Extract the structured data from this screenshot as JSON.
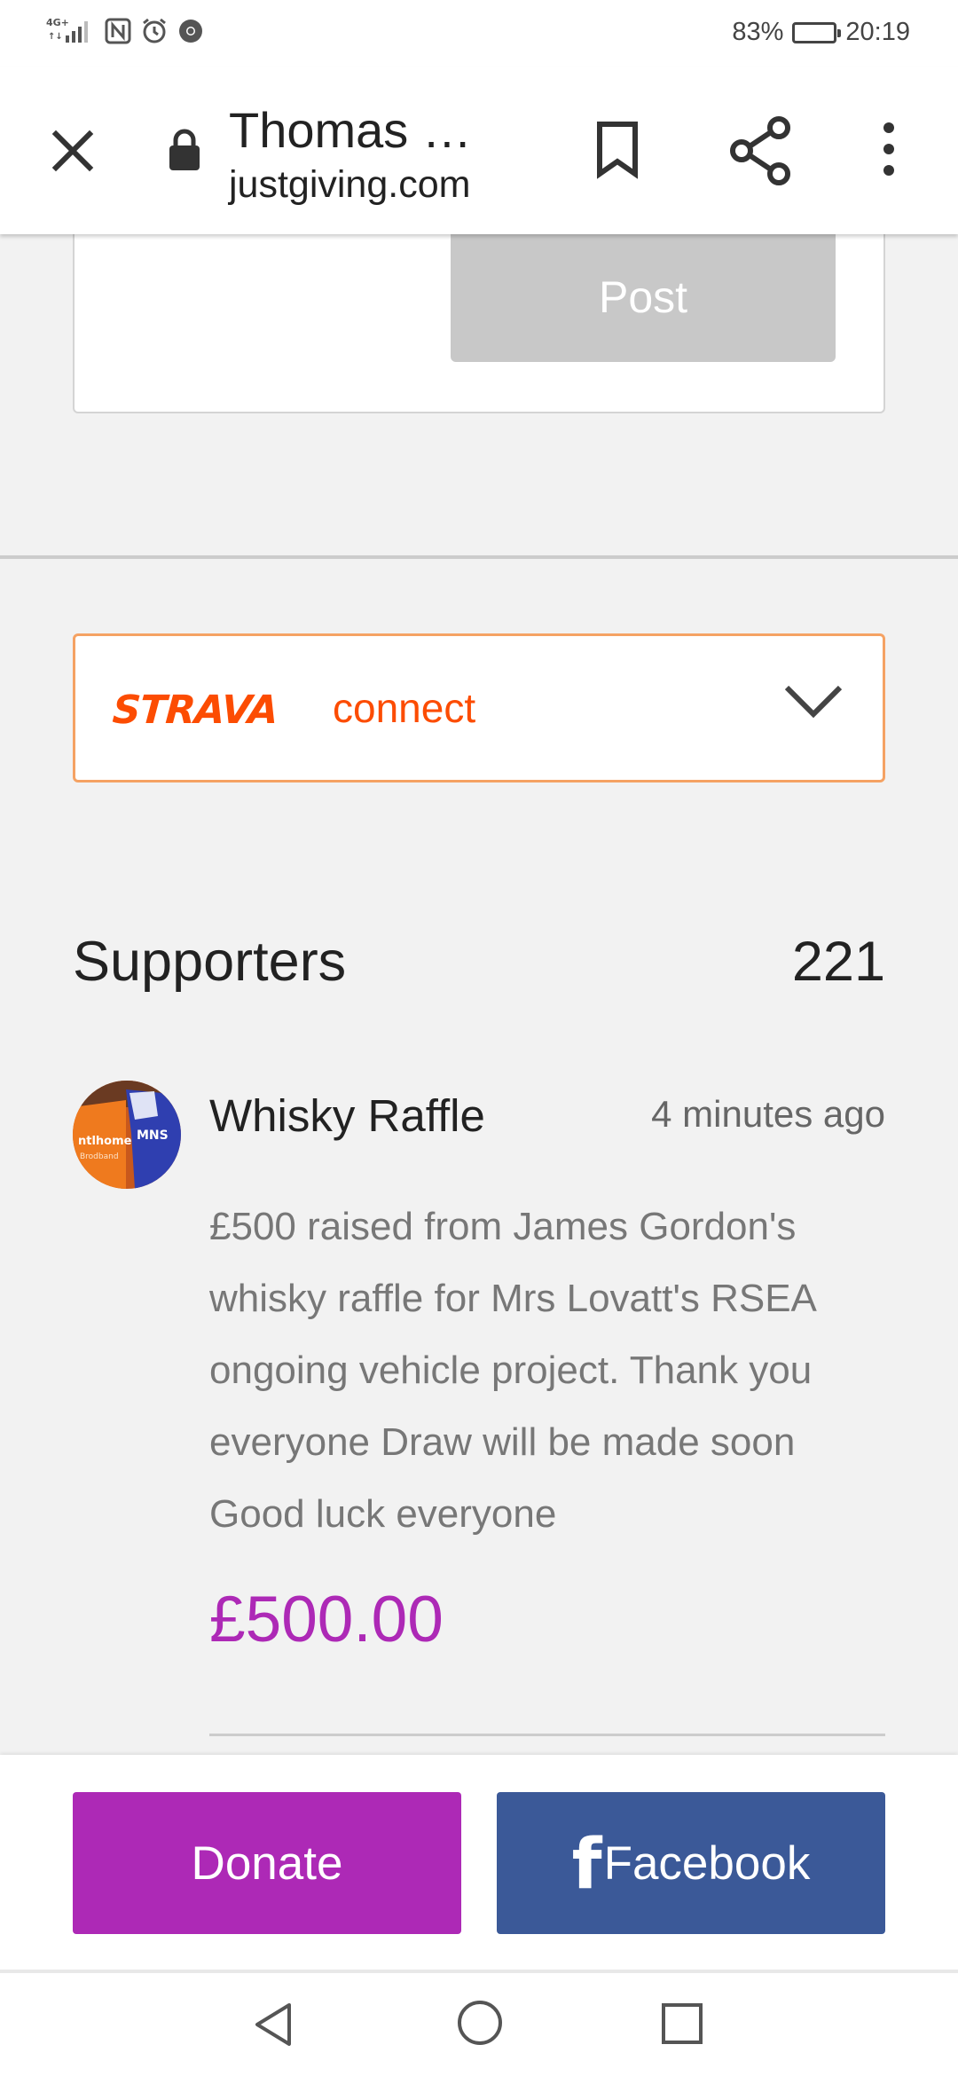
{
  "status_bar": {
    "network": "4G+",
    "battery_percent": "83%",
    "battery_level": 0.83,
    "time": "20:19",
    "icons": [
      "signal-icon",
      "nfc-icon",
      "alarm-icon",
      "chrome-icon"
    ]
  },
  "browser": {
    "page_title": "Thomas …",
    "url": "justgiving.com",
    "icons": [
      "close-icon",
      "lock-icon",
      "bookmark-icon",
      "share-icon",
      "more-vert-icon"
    ]
  },
  "comment_box": {
    "post_label": "Post"
  },
  "strava": {
    "logo_text": "STRAVA",
    "connect_label": "connect",
    "brand_color": "#fc4c02"
  },
  "supporters": {
    "title": "Supporters",
    "count": "221",
    "items": [
      {
        "name": "Whisky Raffle",
        "time": "4 minutes ago",
        "message": "£500 raised from James Gordon's whisky raffle for Mrs Lovatt's RSEA ongoing vehicle project. Thank you everyone Draw will be made soon Good luck everyone",
        "amount": "£500.00"
      }
    ]
  },
  "actions": {
    "donate_label": "Donate",
    "facebook_label": "Facebook",
    "donate_color": "#ad29b6",
    "facebook_color": "#3b5998"
  },
  "nav": {
    "icons": [
      "back-icon",
      "home-icon",
      "recents-icon"
    ]
  }
}
